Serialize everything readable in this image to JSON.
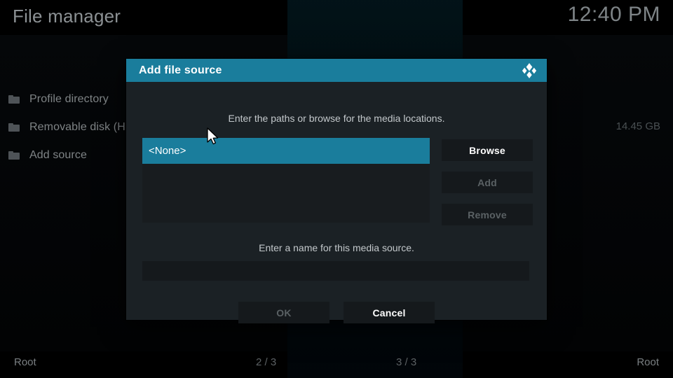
{
  "header": {
    "app_title": "File manager",
    "clock": "12:40 PM"
  },
  "sidebar": {
    "items": [
      {
        "icon": "folder-icon",
        "label": "Profile directory"
      },
      {
        "icon": "folder-icon",
        "label": "Removable disk (H:)",
        "size": "14.45 GB"
      },
      {
        "icon": "folder-icon",
        "label": "Add source"
      }
    ],
    "removable_disk_size": "14.45 GB"
  },
  "statusbar": {
    "left_path": "Root",
    "left_page": "2 / 3",
    "right_page": "3 / 3",
    "right_path": "Root"
  },
  "dialog": {
    "title": "Add file source",
    "logo_icon": "kodi-logo-icon",
    "paths_hint": "Enter the paths or browse for the media locations.",
    "name_hint": "Enter a name for this media source.",
    "path_list": [
      {
        "label": "<None>",
        "selected": true
      }
    ],
    "side_buttons": [
      {
        "label": "Browse",
        "enabled": true
      },
      {
        "label": "Add",
        "enabled": false
      },
      {
        "label": "Remove",
        "enabled": false
      }
    ],
    "name_value": "",
    "name_placeholder": "",
    "footer_buttons": [
      {
        "label": "OK",
        "enabled": false
      },
      {
        "label": "Cancel",
        "enabled": true
      }
    ]
  },
  "colors": {
    "accent_teal": "#1a7d9c",
    "dialog_bg": "#1b2125",
    "control_bg": "#15191c",
    "list_bg": "#181c1f",
    "text_primary": "#ffffff",
    "text_muted": "#5a6164",
    "screen_bg": "#000000"
  }
}
